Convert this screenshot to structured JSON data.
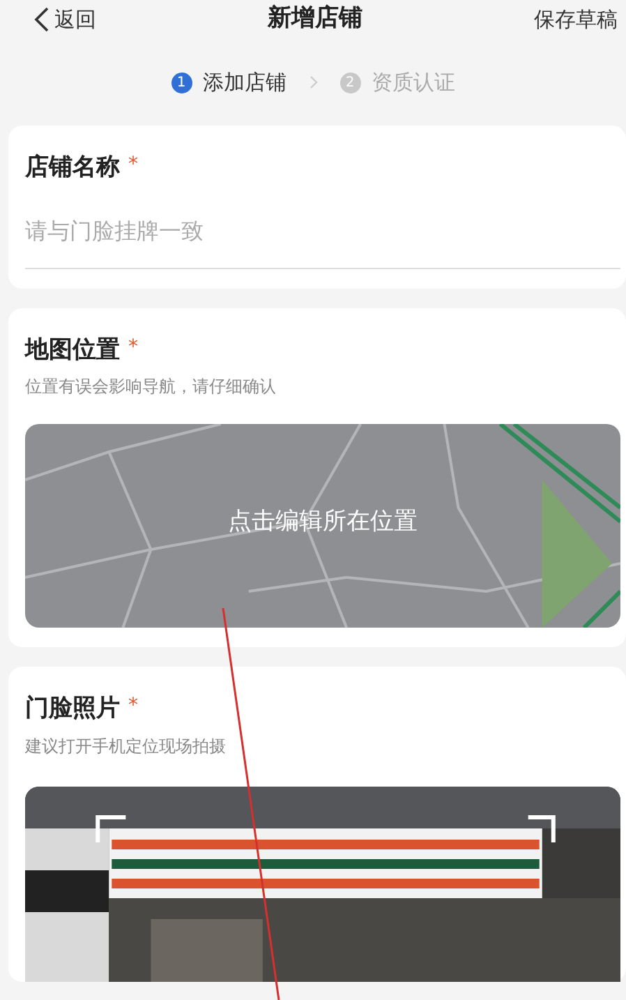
{
  "header": {
    "back_icon_text": "返回",
    "title": "新增店铺",
    "action": "保存草稿"
  },
  "steps": [
    {
      "number": "1",
      "label": "添加店铺",
      "selected": true
    },
    {
      "number": "2",
      "label": "资质认证",
      "selected": false
    }
  ],
  "sections": [
    {
      "kind": "input",
      "title": "店铺名称",
      "required_mark": "*",
      "placeholder": "请与门脸挂牌一致"
    },
    {
      "kind": "map",
      "title": "地图位置",
      "required_mark": "*",
      "hint": "位置有误会影响导航，请仔细确认",
      "map_label": "点击编辑所在位置"
    },
    {
      "title": "门脸照片",
      "required_mark": "*",
      "hint": "建议打开手机定位现场拍摄"
    }
  ]
}
